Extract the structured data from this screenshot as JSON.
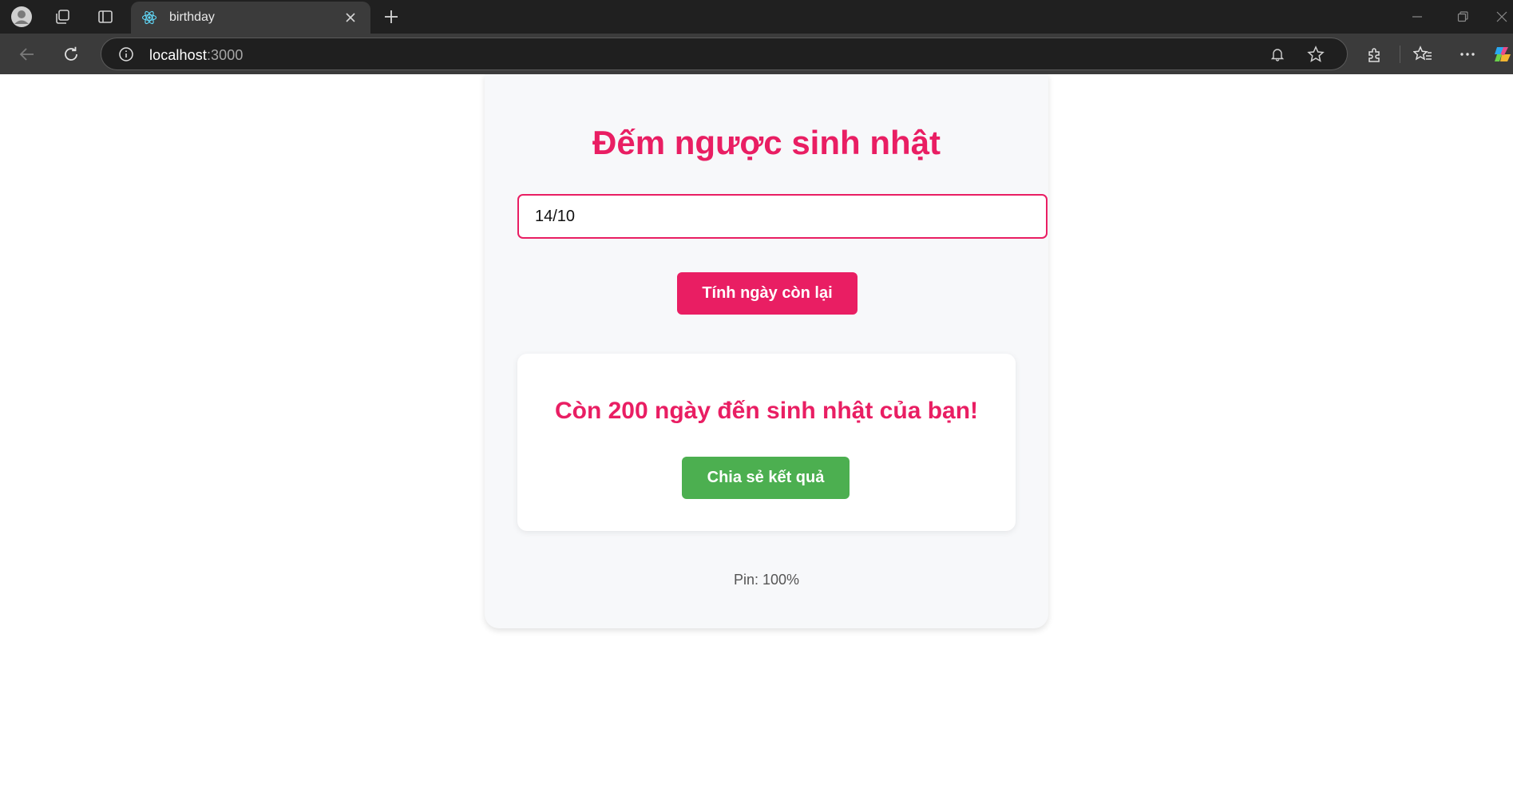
{
  "browser": {
    "tab_title": "birthday",
    "url_host": "localhost",
    "url_port": ":3000",
    "icons": {
      "profile": "profile-icon",
      "workspaces": "workspaces-icon",
      "vertical_tabs": "vertical-tabs-icon",
      "favicon": "react-favicon",
      "close_tab": "close-icon",
      "new_tab": "plus-icon",
      "back": "back-arrow-icon",
      "reload": "reload-icon",
      "site_info": "info-icon",
      "notifications": "bell-icon",
      "favorite": "star-icon",
      "extensions": "puzzle-icon",
      "favorites": "favorites-icon",
      "more": "more-icon",
      "copilot": "copilot-icon",
      "minimize": "minimize-icon",
      "restore": "restore-icon",
      "close_window": "close-window-icon"
    }
  },
  "app": {
    "title": "Đếm ngược sinh nhật",
    "date_input_value": "14/10",
    "calculate_label": "Tính ngày còn lại",
    "result_text": "Còn 200 ngày đến sinh nhật của bạn!",
    "share_label": "Chia sẻ kết quả",
    "battery_label": "Pin:",
    "battery_value": "100%",
    "colors": {
      "accent": "#e91e63",
      "share": "#4caf50",
      "card_bg": "#f7f8fa"
    }
  }
}
